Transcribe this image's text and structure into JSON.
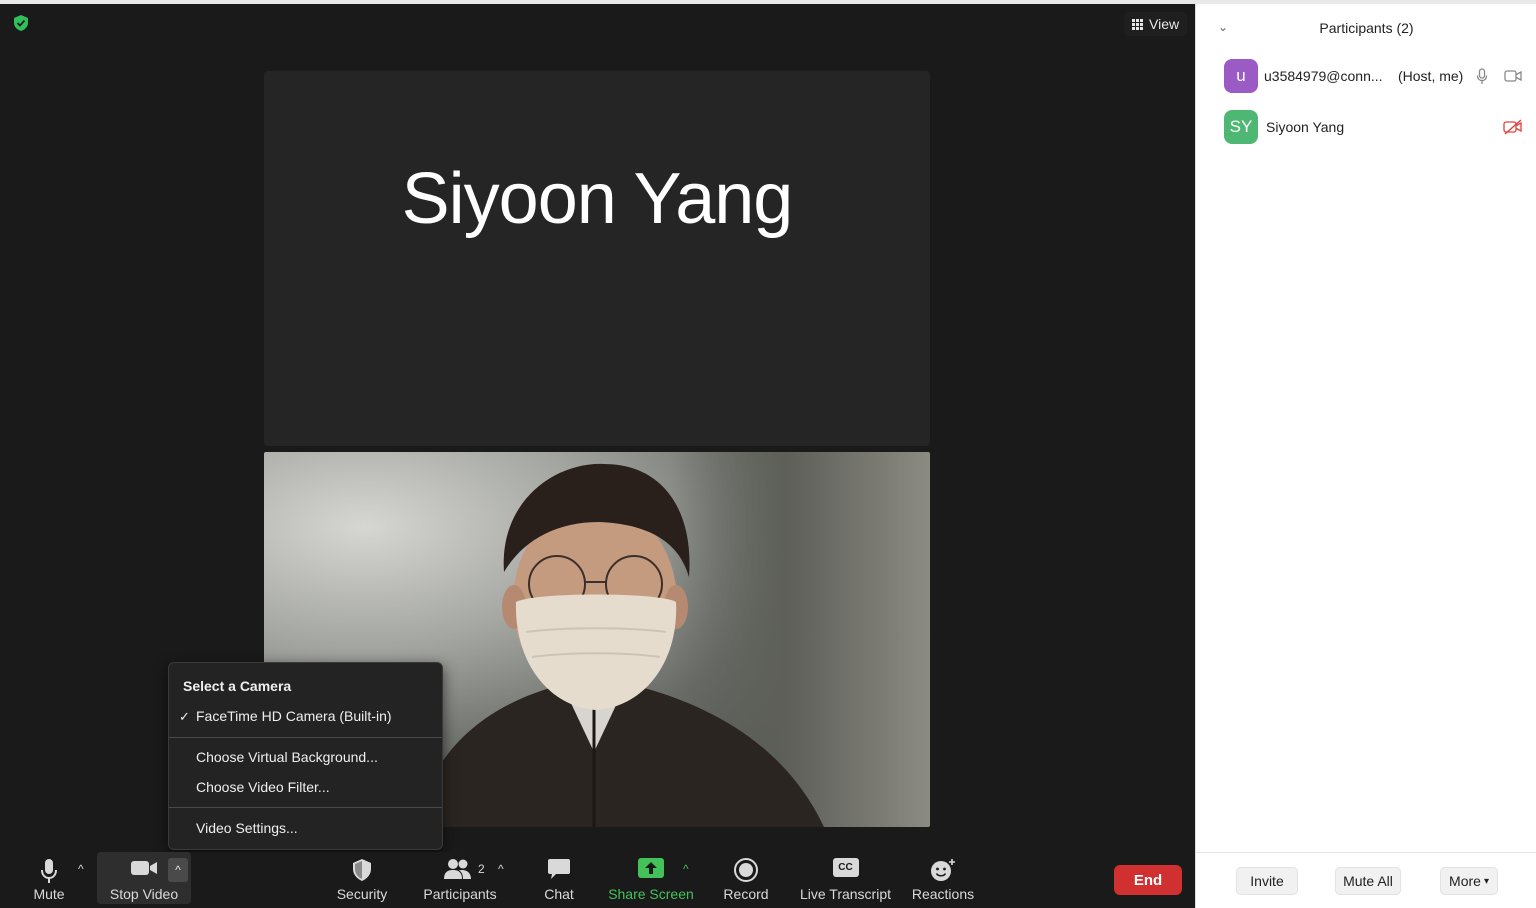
{
  "meeting": {
    "view_label": "View",
    "participant_tile_name": "Siyoon Yang"
  },
  "camera_menu": {
    "header": "Select a Camera",
    "camera_option": "FaceTime HD Camera (Built-in)",
    "virtual_background": "Choose Virtual Background...",
    "video_filter": "Choose Video Filter...",
    "video_settings": "Video Settings..."
  },
  "toolbar": {
    "mute": "Mute",
    "stop_video": "Stop Video",
    "security": "Security",
    "participants": "Participants",
    "participants_count": "2",
    "chat": "Chat",
    "share_screen": "Share Screen",
    "record": "Record",
    "live_transcript": "Live Transcript",
    "reactions": "Reactions",
    "end": "End",
    "cc_badge": "CC"
  },
  "panel": {
    "title": "Participants (2)",
    "participants": [
      {
        "initials": "u",
        "name": "u3584979@conn...",
        "role": "(Host, me)",
        "avatar_color": "#9b5bc4"
      },
      {
        "initials": "SY",
        "name": "Siyoon Yang",
        "role": "",
        "avatar_color": "#4fb774"
      }
    ],
    "footer": {
      "invite": "Invite",
      "mute_all": "Mute All",
      "more": "More"
    }
  },
  "colors": {
    "share_green": "#43c25a",
    "end_red": "#d0302f",
    "video_off_red": "#e0433e",
    "shield_green": "#2fbf5b"
  }
}
